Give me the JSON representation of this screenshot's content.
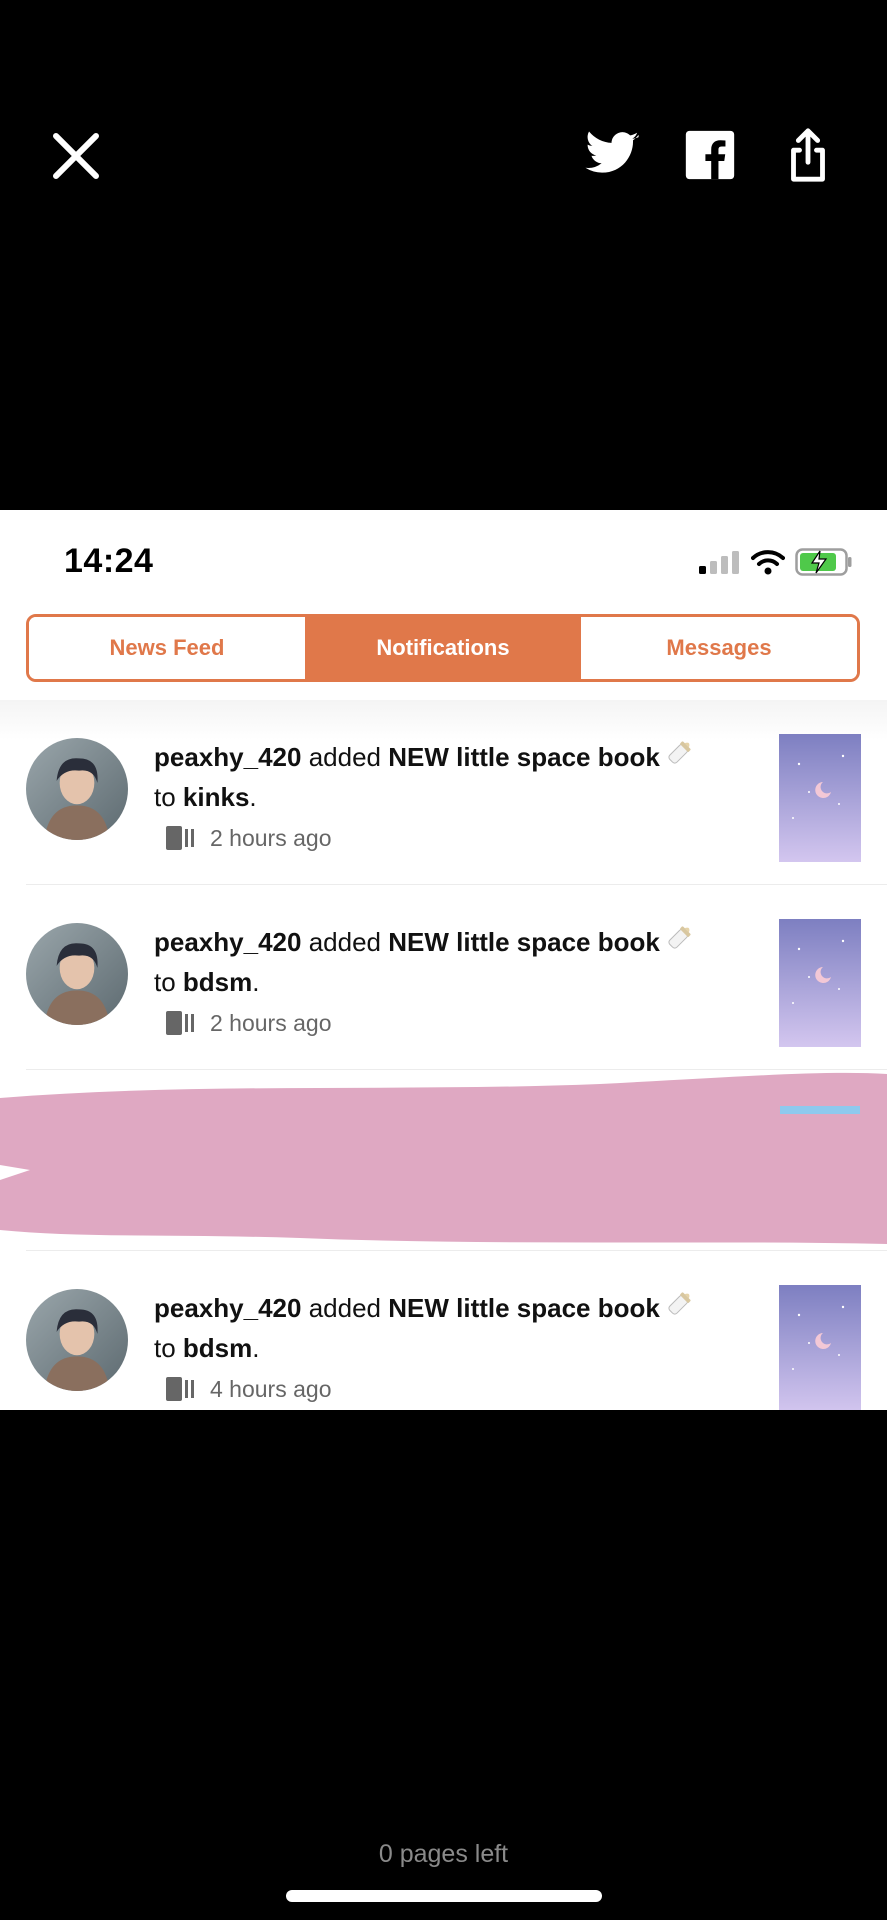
{
  "status_bar": {
    "time": "14:24"
  },
  "tabs": [
    {
      "label": "News Feed",
      "active": false
    },
    {
      "label": "Notifications",
      "active": true
    },
    {
      "label": "Messages",
      "active": false
    }
  ],
  "notifications": [
    {
      "user": "peaxhy_420",
      "action": "added",
      "story": "NEW little space book",
      "joiner": "to",
      "list": "kinks",
      "time": "2 hours ago"
    },
    {
      "user": "peaxhy_420",
      "action": "added",
      "story": "NEW little space book",
      "joiner": "to",
      "list": "bdsm",
      "time": "2 hours ago"
    },
    {
      "user": "peaxhy_420",
      "action": "added",
      "story": "NEW little space book",
      "joiner": "to",
      "list": "bdsm",
      "time": "4 hours ago"
    }
  ],
  "footer": {
    "pages_left": "0 pages left"
  },
  "colors": {
    "accent": "#e0784a",
    "redaction": "#dfa8c2"
  },
  "icons": [
    "close-icon",
    "twitter-icon",
    "facebook-icon",
    "share-icon",
    "signal-icon",
    "wifi-icon",
    "battery-icon",
    "reading-list-icon",
    "baby-bottle-icon"
  ]
}
